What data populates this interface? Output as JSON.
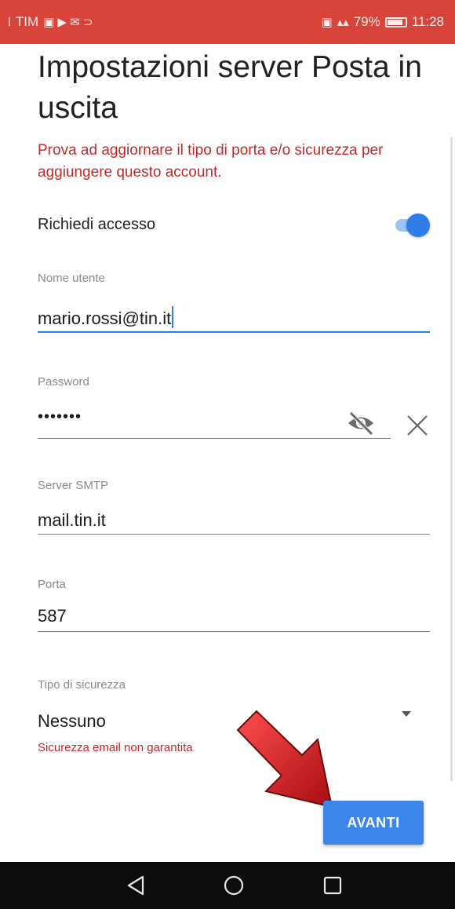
{
  "status_bar": {
    "carrier": "TIM",
    "battery": "79%",
    "time": "11:28"
  },
  "page": {
    "title": "Impostazioni server Posta in uscita"
  },
  "error_message": "Prova ad aggiornare il tipo di porta e/o sicurezza per aggiungere questo account.",
  "require_login": {
    "label": "Richiedi accesso",
    "enabled": true
  },
  "fields": {
    "username": {
      "label": "Nome utente",
      "value": "mario.rossi@tin.it"
    },
    "password": {
      "label": "Password",
      "value": "•••••••"
    },
    "smtp_server": {
      "label": "Server SMTP",
      "value": "mail.tin.it"
    },
    "port": {
      "label": "Porta",
      "value": "587"
    },
    "security": {
      "label": "Tipo di sicurezza",
      "value": "Nessuno",
      "warning": "Sicurezza email non garantita"
    }
  },
  "actions": {
    "next_label": "AVANTI"
  },
  "icons": {
    "password_visibility": "eye-off-icon",
    "clear": "close-icon",
    "dropdown": "triangle-down-icon",
    "annotation": "red-arrow-icon"
  },
  "colors": {
    "status_bar": "#d9443a",
    "accent": "#2f7de8",
    "error": "#c62828",
    "button": "#3b86e8",
    "annotation_arrow": "#d0141a"
  }
}
